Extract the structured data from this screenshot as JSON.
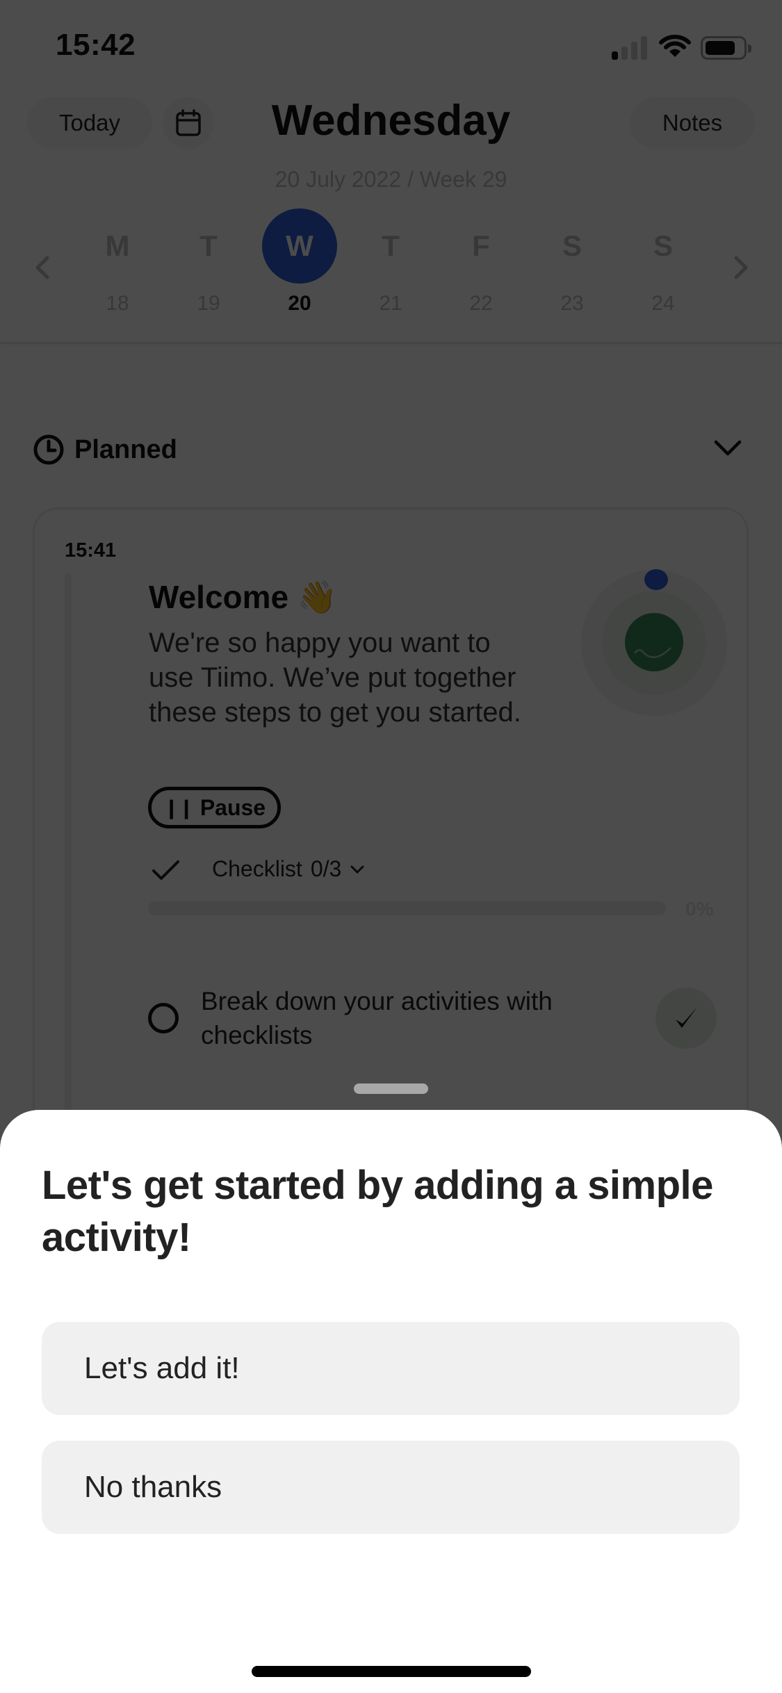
{
  "status_bar": {
    "time": "15:42",
    "signal_bars_active": 1,
    "signal_bars_total": 4,
    "icons": [
      "signal-icon",
      "wifi-icon",
      "battery-icon"
    ]
  },
  "header": {
    "today_label": "Today",
    "calendar_icon": "calendar-icon",
    "title": "Wednesday",
    "subtitle": "20 July 2022 / Week 29",
    "notes_label": "Notes"
  },
  "week": {
    "prev_icon": "chevron-left-icon",
    "next_icon": "chevron-right-icon",
    "days": [
      {
        "letter": "M",
        "num": "18"
      },
      {
        "letter": "T",
        "num": "19"
      },
      {
        "letter": "W",
        "num": "20",
        "active": true
      },
      {
        "letter": "T",
        "num": "21"
      },
      {
        "letter": "F",
        "num": "22"
      },
      {
        "letter": "S",
        "num": "23"
      },
      {
        "letter": "S",
        "num": "24"
      }
    ]
  },
  "planned": {
    "label": "Planned",
    "icon": "clock-icon",
    "toggle_icon": "chevron-down-icon"
  },
  "activity": {
    "time": "15:41",
    "title": "Welcome",
    "emoji": "👋",
    "body": "We're so happy you want to use Tiimo. We’ve put together these steps to get you started.",
    "pause_label": "Pause",
    "checklist_label": "Checklist",
    "checklist_count": "0/3",
    "progress_percent": 0,
    "progress_label": "0%",
    "tasks": [
      {
        "text": "Break down your activities with checklists",
        "done": false
      }
    ]
  },
  "sheet": {
    "title": "Let's get started by adding a simple activity!",
    "buttons": {
      "add": "Let's add it!",
      "decline": "No thanks"
    }
  },
  "colors": {
    "accent_blue": "#2e5fd6",
    "accent_green": "#3b8a57",
    "overlay": "rgba(0,0,0,0.7)",
    "button_bg": "#f0f0f0"
  }
}
